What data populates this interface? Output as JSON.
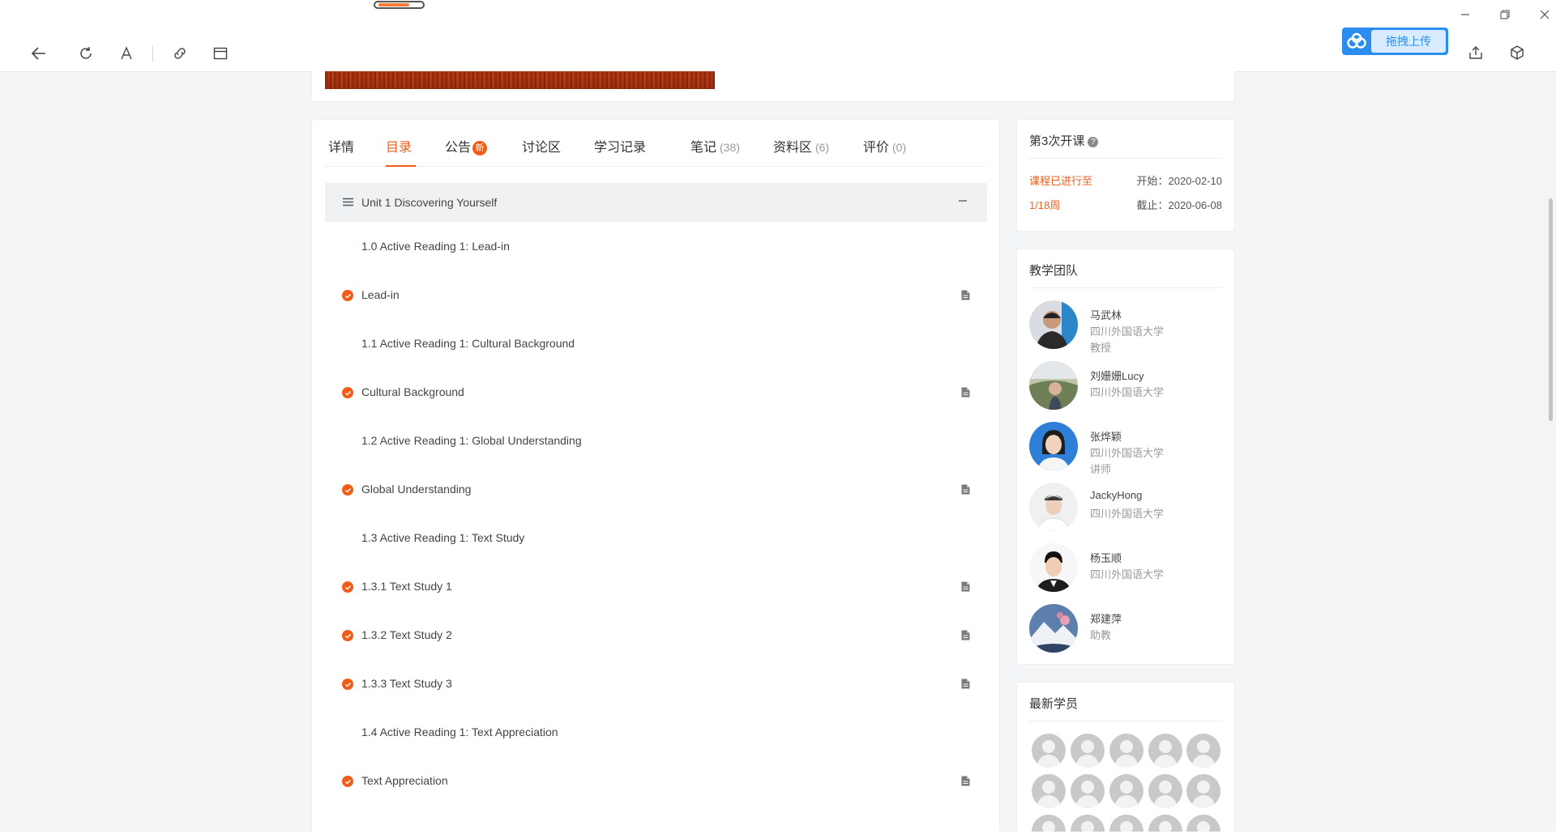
{
  "upload": {
    "label": "拖拽上传"
  },
  "tabs": [
    {
      "label": "详情",
      "count": ""
    },
    {
      "label": "目录",
      "count": ""
    },
    {
      "label": "公告",
      "count": "",
      "badge": "新"
    },
    {
      "label": "讨论区",
      "count": ""
    },
    {
      "label": "学习记录",
      "count": ""
    },
    {
      "label": "笔记",
      "count": "(38)"
    },
    {
      "label": "资料区",
      "count": "(6)"
    },
    {
      "label": "评价",
      "count": "(0)"
    }
  ],
  "active_tab": "目录",
  "unit": {
    "title": "Unit 1 Discovering Yourself"
  },
  "rows": [
    {
      "text": "1.0 Active Reading 1: Lead-in",
      "kind": "section"
    },
    {
      "text": "Lead-in",
      "kind": "item",
      "done": true
    },
    {
      "text": "1.1 Active Reading 1: Cultural Background",
      "kind": "section"
    },
    {
      "text": "Cultural Background",
      "kind": "item",
      "done": true
    },
    {
      "text": "1.2 Active Reading 1: Global Understanding",
      "kind": "section"
    },
    {
      "text": "Global Understanding",
      "kind": "item",
      "done": true
    },
    {
      "text": "1.3 Active Reading 1: Text Study",
      "kind": "section"
    },
    {
      "text": "1.3.1 Text Study 1",
      "kind": "item",
      "done": true
    },
    {
      "text": "1.3.2 Text Study 2",
      "kind": "item",
      "done": true
    },
    {
      "text": "1.3.3 Text Study 3",
      "kind": "item",
      "done": true
    },
    {
      "text": "1.4 Active Reading 1: Text Appreciation",
      "kind": "section"
    },
    {
      "text": "Text Appreciation",
      "kind": "item",
      "done": true
    }
  ],
  "session": {
    "title": "第3次开课",
    "progress_label": "课程已进行至",
    "progress_week": "1/18周",
    "start": "开始：2020-02-10",
    "end": "截止：2020-06-08"
  },
  "team": {
    "title": "教学团队",
    "members": [
      {
        "name": "马武林",
        "school": "四川外国语大学",
        "role": "教授"
      },
      {
        "name": "刘姗姗Lucy",
        "school": "四川外国语大学",
        "role": ""
      },
      {
        "name": "张烨颖",
        "school": "四川外国语大学",
        "role": "讲师"
      },
      {
        "name": "JackyHong",
        "school": "四川外国语大学",
        "role": ""
      },
      {
        "name": "杨玉顺",
        "school": "四川外国语大学",
        "role": ""
      },
      {
        "name": "郑建萍",
        "school": "助教",
        "role": ""
      }
    ]
  },
  "students": {
    "title": "最新学员"
  },
  "colors": {
    "accent": "#f25c19",
    "upload_blue": "#2b8df0"
  }
}
